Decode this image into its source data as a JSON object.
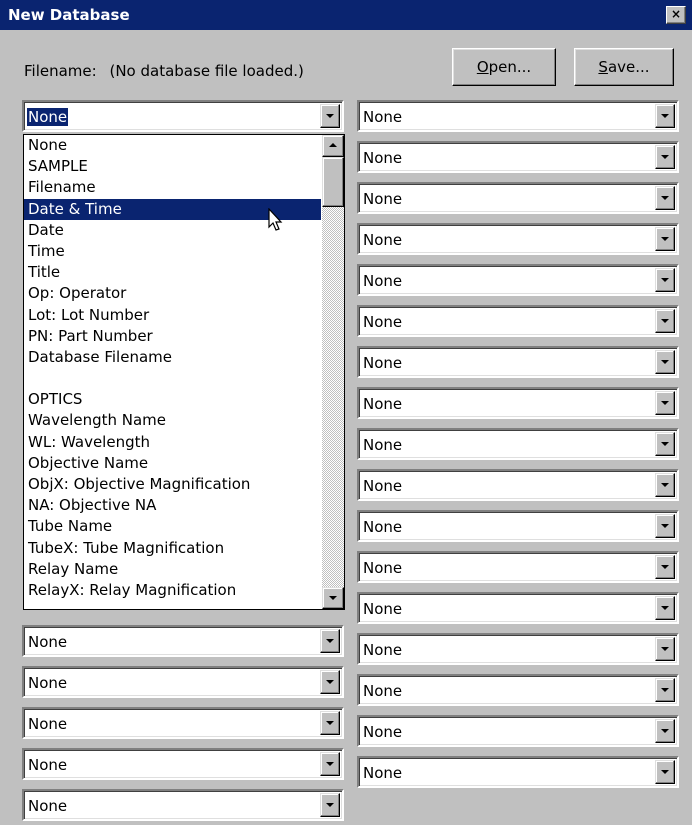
{
  "window": {
    "title": "New Database",
    "close_glyph": "×"
  },
  "filename": {
    "label": "Filename:",
    "value": "(No database file loaded.)"
  },
  "buttons": {
    "open_label": "Open...",
    "open_mnemonic": "O",
    "open_rest": "pen...",
    "save_mnemonic": "S",
    "save_rest": "ave..."
  },
  "open_combo": {
    "value": "None"
  },
  "dropdown_items": [
    "None",
    "SAMPLE",
    "Filename",
    "Date & Time",
    "Date",
    "Time",
    "Title",
    "Op:  Operator",
    "Lot:  Lot Number",
    "PN:  Part Number",
    "Database Filename",
    "",
    "OPTICS",
    "Wavelength Name",
    "WL:  Wavelength",
    "Objective Name",
    "ObjX:  Objective Magnification",
    "NA:  Objective NA",
    "Tube Name",
    "TubeX:  Tube Magnification",
    "Relay Name",
    "RelayX:  Relay Magnification"
  ],
  "highlighted_item": "Date & Time",
  "left_combos": [
    "None",
    "None",
    "None",
    "None",
    "None"
  ],
  "right_combos": [
    "None",
    "None",
    "None",
    "None",
    "None",
    "None",
    "None",
    "None",
    "None",
    "None",
    "None",
    "None",
    "None",
    "None",
    "None",
    "None",
    "None"
  ],
  "colors": {
    "title_bar": "#0a2470",
    "selection": "#0a2470",
    "face": "#c0c0c0"
  },
  "icons": {
    "cursor": "arrow-cursor-icon"
  }
}
